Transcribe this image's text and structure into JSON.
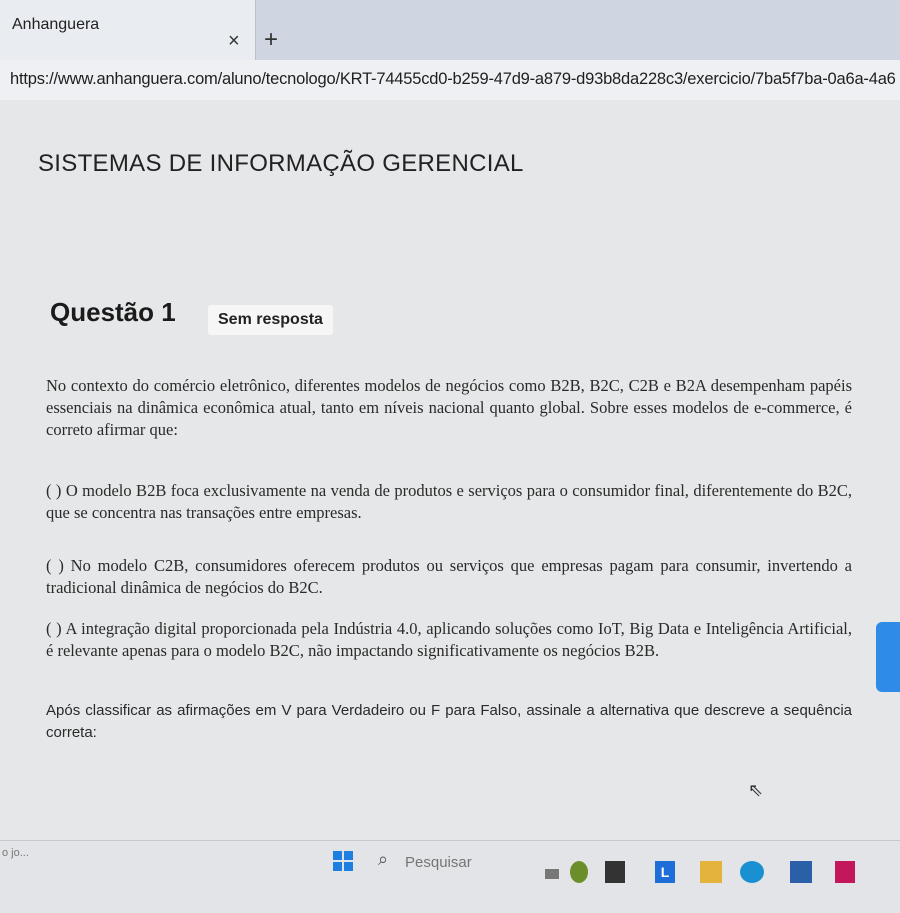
{
  "browser": {
    "tab_title": "Anhanguera",
    "tab_close": "×",
    "new_tab": "+",
    "url": "https://www.anhanguera.com/aluno/tecnologo/KRT-74455cd0-b259-47d9-a879-d93b8da228c3/exercicio/7ba5f7ba-0a6a-4a6"
  },
  "page": {
    "course_title": "SISTEMAS DE INFORMAÇÃO GERENCIAL",
    "question_label": "Questão 1",
    "status_badge": "Sem resposta",
    "statement": "No contexto do comércio eletrônico, diferentes modelos de negócios como B2B, B2C, C2B e B2A desempenham papéis essenciais na dinâmica econômica atual, tanto em níveis nacional quanto global. Sobre esses modelos de e-commerce, é correto afirmar que:",
    "assertions": [
      "( ) O modelo B2B foca exclusivamente na venda de produtos e serviços para o consumidor final, diferentemente do B2C, que se concentra nas transações entre empresas.",
      "( ) No modelo C2B, consumidores oferecem produtos ou serviços que empresas pagam para consumir, invertendo a tradicional dinâmica de negócios do B2C.",
      "( ) A integração digital proporcionada pela Indústria 4.0, aplicando soluções como IoT, Big Data e Inteligência Artificial, é relevante apenas para o modelo B2C, não impactando significativamente os negócios B2B."
    ],
    "instruction": "Após classificar as afirmações em V para Verdadeiro ou F para Falso, assinale a alternativa que descreve a sequência correta:"
  },
  "taskbar": {
    "left_text": "o jo...",
    "search_placeholder": "Pesquisar",
    "app_letter": "L"
  }
}
